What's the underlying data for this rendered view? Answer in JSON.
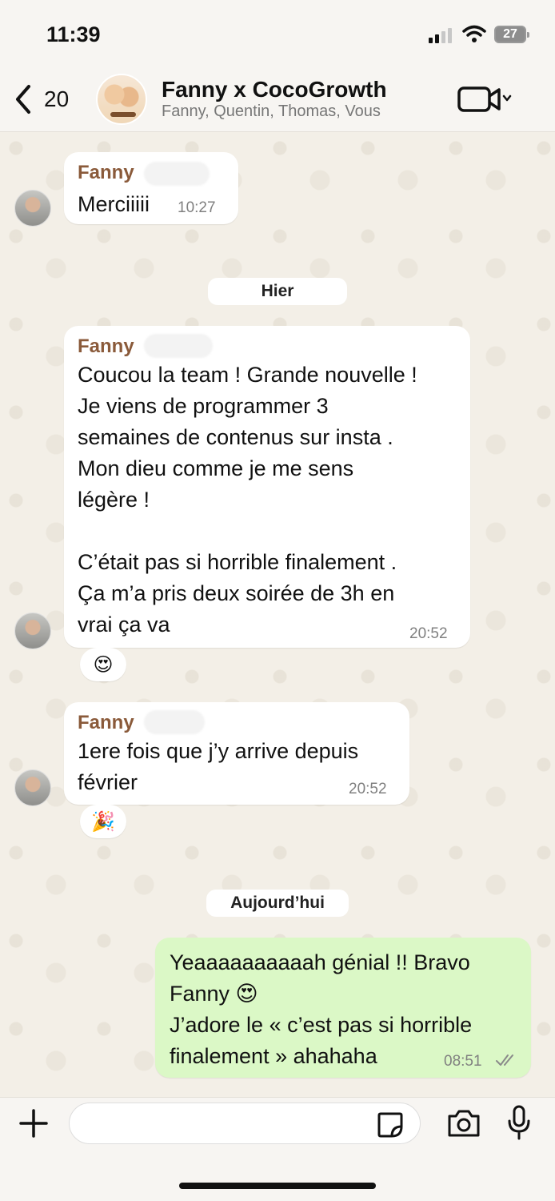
{
  "status_bar": {
    "time": "11:39",
    "battery": "27"
  },
  "header": {
    "back_count": "20",
    "title": "Fanny x CocoGrowth",
    "members": "Fanny, Quentin, Thomas, Vous"
  },
  "messages": [
    {
      "sender": "Fanny",
      "text": "Merciiiii",
      "time": "10:27"
    },
    {
      "date": "Hier"
    },
    {
      "sender": "Fanny",
      "text": "Coucou la team ! Grande nouvelle !\nJe viens de programmer 3\nsemaines de contenus sur insta .\nMon dieu comme je me sens\nlégère !\n\nC’était pas si horrible finalement .\nÇa m’a pris deux soirée de 3h en\nvrai ça va",
      "time": "20:52",
      "reaction": "😍"
    },
    {
      "sender": "Fanny",
      "text": "1ere fois que j’y arrive depuis\nfévrier",
      "time": "20:52",
      "reaction": "🎉"
    },
    {
      "date": "Aujourd’hui"
    },
    {
      "sender": "Vous",
      "text": "Yeaaaaaaaaaah génial !! Bravo\nFanny 😍\nJ’adore le « c’est pas si horrible\nfinalement » ahahaha",
      "time": "08:51"
    }
  ],
  "icons": {
    "back": "chevron-left-icon",
    "video": "video-call-icon",
    "plus": "plus-icon",
    "sticker": "sticker-icon",
    "camera": "camera-icon",
    "mic": "microphone-icon"
  },
  "colors": {
    "sender_name": "#8a5a3a",
    "outgoing_bubble": "#dbf8c6",
    "chat_background": "#f3efe7"
  }
}
